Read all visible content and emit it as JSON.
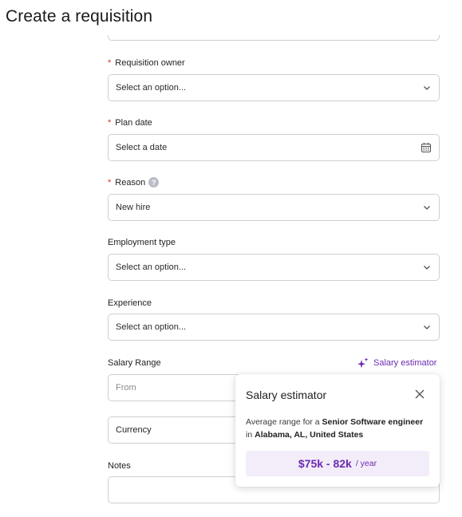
{
  "page": {
    "title": "Create a requisition"
  },
  "form": {
    "requisition_owner": {
      "label": "Requisition owner",
      "required_mark": "*",
      "value": "Select an option..."
    },
    "plan_date": {
      "label": "Plan date",
      "required_mark": "*",
      "value": "Select a date"
    },
    "reason": {
      "label": "Reason",
      "required_mark": "*",
      "help": "?",
      "value": "New hire"
    },
    "employment_type": {
      "label": "Employment type",
      "value": "Select an option..."
    },
    "experience": {
      "label": "Experience",
      "value": "Select an option..."
    },
    "salary_range": {
      "label": "Salary Range",
      "from_placeholder": "From",
      "currency_value": "Currency"
    },
    "notes": {
      "label": "Notes"
    }
  },
  "salary_estimator": {
    "link_label": "Salary estimator",
    "popover": {
      "title": "Salary estimator",
      "desc_prefix": "Average range for a",
      "role": "Senior Software engineer",
      "desc_in": "in",
      "location": "Alabama, AL, United States",
      "range": "$75k - 82k",
      "unit": "/ year"
    }
  },
  "colors": {
    "accent": "#6b2bb0",
    "required": "#d93025",
    "range_bg": "#f3edfa",
    "border": "#cfcfcf"
  },
  "icons": [
    "chevron-down-icon",
    "calendar-icon",
    "sparkle-icon",
    "close-icon",
    "help-icon"
  ]
}
